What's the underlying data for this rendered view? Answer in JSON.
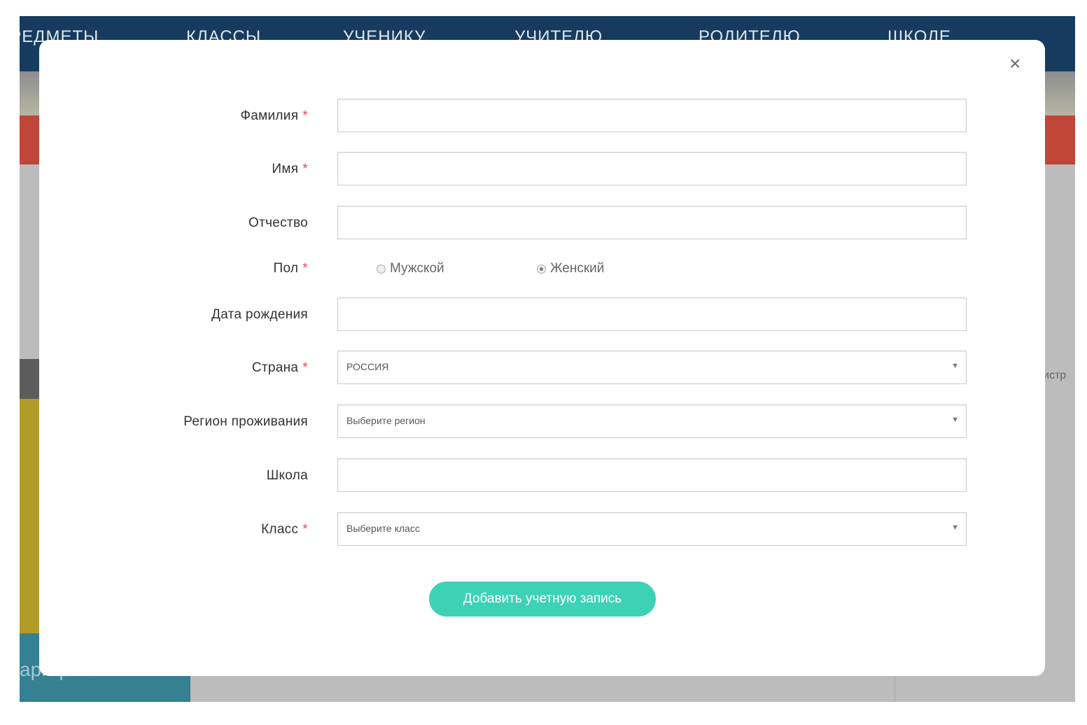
{
  "nav": {
    "items": [
      "ПРЕДМЕТЫ",
      "КЛАССЫ",
      "УЧЕНИКУ",
      "УЧИТЕЛЮ",
      "РОДИТЕЛЮ",
      "ШКОЛЕ"
    ]
  },
  "background": {
    "teal_text": "аргарита",
    "side_text": "истр"
  },
  "modal": {
    "close_icon": "close-icon",
    "fields": {
      "surname": {
        "label": "Фамилия",
        "required": "*",
        "value": ""
      },
      "name": {
        "label": "Имя",
        "required": "*",
        "value": ""
      },
      "patronymic": {
        "label": "Отчество",
        "value": ""
      },
      "gender": {
        "label": "Пол",
        "required": "*",
        "options": [
          "Мужской",
          "Женский"
        ],
        "selected": "Женский"
      },
      "birthdate": {
        "label": "Дата рождения",
        "value": ""
      },
      "country": {
        "label": "Страна",
        "required": "*",
        "value": "РОССИЯ"
      },
      "region": {
        "label": "Регион проживания",
        "placeholder": "Выберите регион"
      },
      "school": {
        "label": "Школа",
        "value": ""
      },
      "grade": {
        "label": "Класс",
        "required": "*",
        "placeholder": "Выберите класс"
      }
    },
    "submit_label": "Добавить учетную запись",
    "accent": "#3dd1b5"
  }
}
